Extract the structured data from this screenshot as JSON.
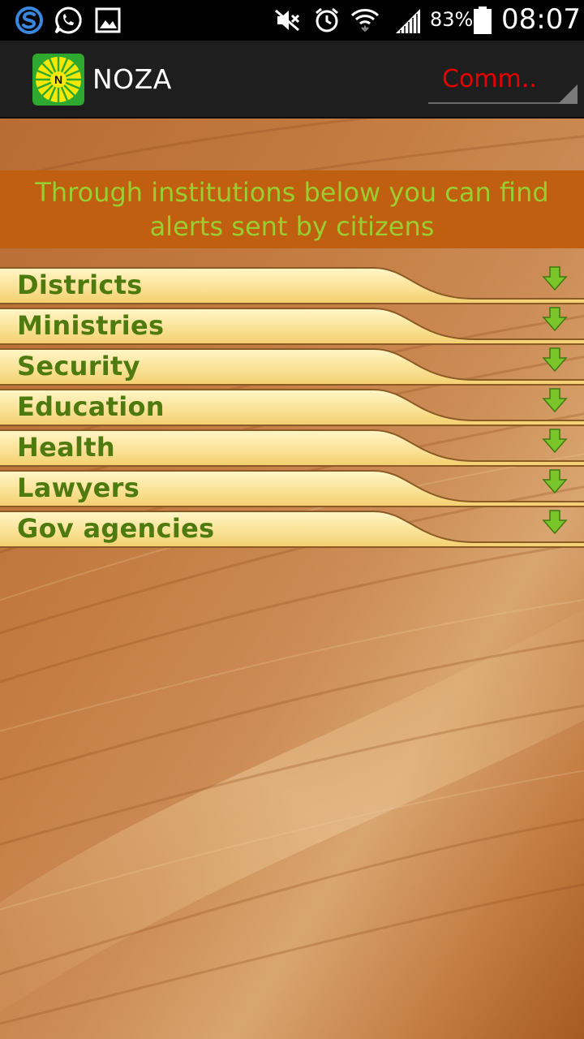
{
  "status_bar": {
    "battery_percent": "83%",
    "time": "08:07",
    "icons": [
      "skype-icon",
      "whatsapp-icon",
      "gallery-icon",
      "mute-icon",
      "alarm-icon",
      "wifi-icon",
      "signal-icon",
      "battery-icon"
    ]
  },
  "app_bar": {
    "title": "NOZA",
    "logo_letter": "N",
    "spinner_value": "Comm.."
  },
  "banner": {
    "text": "Through institutions below you can find alerts sent by citizens"
  },
  "categories": [
    {
      "label": "Districts"
    },
    {
      "label": "Ministries"
    },
    {
      "label": "Security"
    },
    {
      "label": "Education"
    },
    {
      "label": "Health"
    },
    {
      "label": "Lawyers"
    },
    {
      "label": "Gov agencies"
    }
  ],
  "colors": {
    "banner_bg": "#c15f10",
    "banner_text": "#9acd32",
    "category_text": "#4e7a10",
    "spinner_text": "#e80000",
    "action_bar_bg": "#1e1e1e",
    "status_bar_bg": "#000000"
  }
}
